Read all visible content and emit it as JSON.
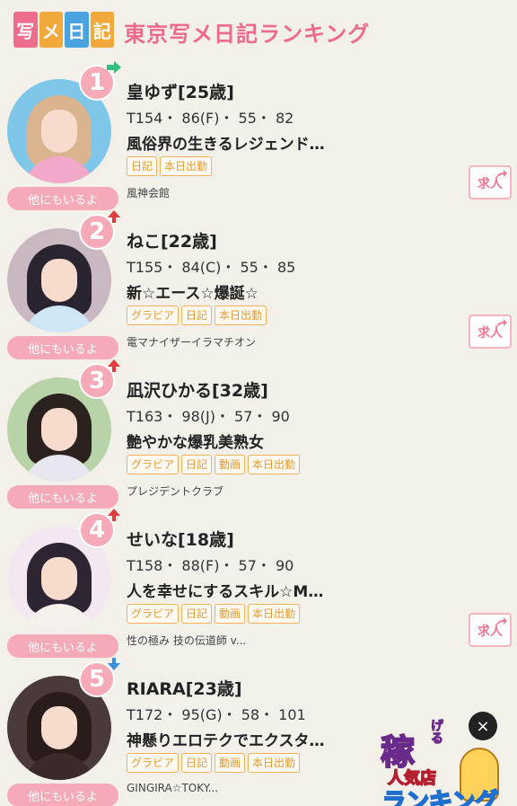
{
  "header": {
    "logo_chars": [
      "写",
      "メ",
      "日",
      "記"
    ],
    "logo_colors": [
      "#ef6d8c",
      "#f2a93b",
      "#4aa3df",
      "#f2a93b"
    ],
    "title": "東京写メ日記ランキング"
  },
  "entries": [
    {
      "rank": "1",
      "trend": "same",
      "trend_color": "#2ec27e",
      "name": "皇ゆず[25歳]",
      "specs": "T154・ 86(F)・ 55・ 82",
      "catch": "風俗界の生きるレジェンド…",
      "tags": [
        "日記",
        "本日出勤"
      ],
      "shop": "風神会館",
      "more": "他にもいるよ",
      "recruit": "求人",
      "palette": {
        "bg": "#7fc7e8",
        "hair": "#d9b48f",
        "body": "#f2a9c9"
      }
    },
    {
      "rank": "2",
      "trend": "up",
      "trend_color": "#e23b3b",
      "name": "ねこ[22歳]",
      "specs": "T155・ 84(C)・ 55・ 85",
      "catch": "新☆エース☆爆誕☆",
      "tags": [
        "グラビア",
        "日記",
        "本日出勤"
      ],
      "shop": "電マナイザーイラマチオン",
      "more": "他にもいるよ",
      "recruit": "求人",
      "palette": {
        "bg": "#c9b8c2",
        "hair": "#2a2430",
        "body": "#cfe6f5"
      }
    },
    {
      "rank": "3",
      "trend": "up",
      "trend_color": "#e23b3b",
      "name": "凪沢ひかる[32歳]",
      "specs": "T163・ 98(J)・ 57・ 90",
      "catch": "艶やかな爆乳美熟女",
      "tags": [
        "グラビア",
        "日記",
        "動画",
        "本日出勤"
      ],
      "shop": "プレジデントクラブ",
      "more": "他にもいるよ",
      "recruit": "",
      "palette": {
        "bg": "#b9d3a8",
        "hair": "#2b2220",
        "body": "#e8e6ef"
      }
    },
    {
      "rank": "4",
      "trend": "up",
      "trend_color": "#e23b3b",
      "name": "せいな[18歳]",
      "specs": "T158・ 88(F)・ 57・ 90",
      "catch": "人を幸せにするスキル☆M…",
      "tags": [
        "グラビア",
        "日記",
        "動画",
        "本日出勤"
      ],
      "shop": "性の極み 技の伝道師 v...",
      "more": "他にもいるよ",
      "recruit": "求人",
      "palette": {
        "bg": "#f3e7f1",
        "hair": "#2e2532",
        "body": "#f7f1ee"
      }
    },
    {
      "rank": "5",
      "trend": "down",
      "trend_color": "#3a8fe0",
      "name": "RIARA[23歳]",
      "specs": "T172・ 95(G)・ 58・ 101",
      "catch": "神懸りエロテクでエクスタ…",
      "tags": [
        "グラビア",
        "日記",
        "動画",
        "本日出勤"
      ],
      "shop": "GINGIRA☆TOKY...",
      "more": "他にもいるよ",
      "recruit": "",
      "palette": {
        "bg": "#4a3a3a",
        "hair": "#2a1c1a",
        "body": "#3a2a2a"
      }
    }
  ],
  "banner": {
    "word1": "稼",
    "word1b": "げる",
    "word2": "人気店",
    "word3": "ランキング",
    "close": "×"
  }
}
